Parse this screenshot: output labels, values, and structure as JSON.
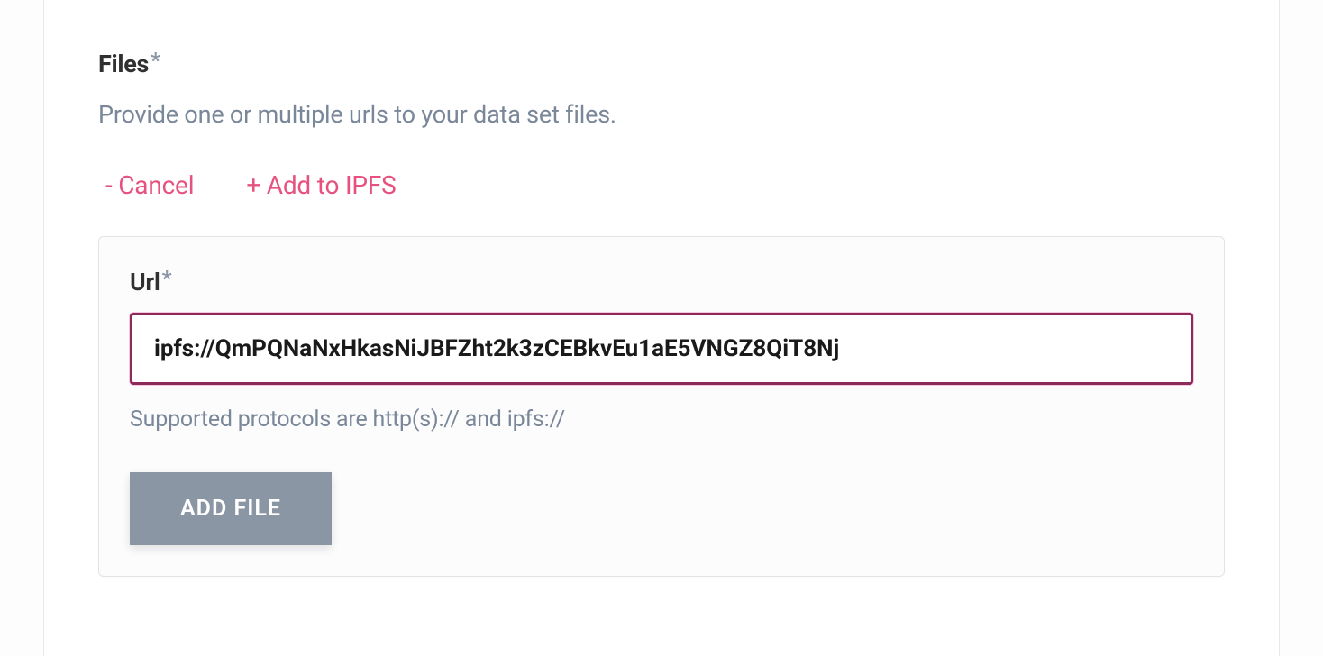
{
  "files_section": {
    "label": "Files",
    "required_marker": "*",
    "description": "Provide one or multiple urls to your data set files.",
    "actions": {
      "cancel": "- Cancel",
      "add_ipfs": "+ Add to IPFS"
    }
  },
  "url_panel": {
    "label": "Url",
    "required_marker": "*",
    "value": "ipfs://QmPQNaNxHkasNiJBFZht2k3zCEBkvEu1aE5VNGZ8QiT8Nj",
    "helper": "Supported protocols are http(s):// and ipfs://",
    "add_file_button": "ADD FILE"
  }
}
